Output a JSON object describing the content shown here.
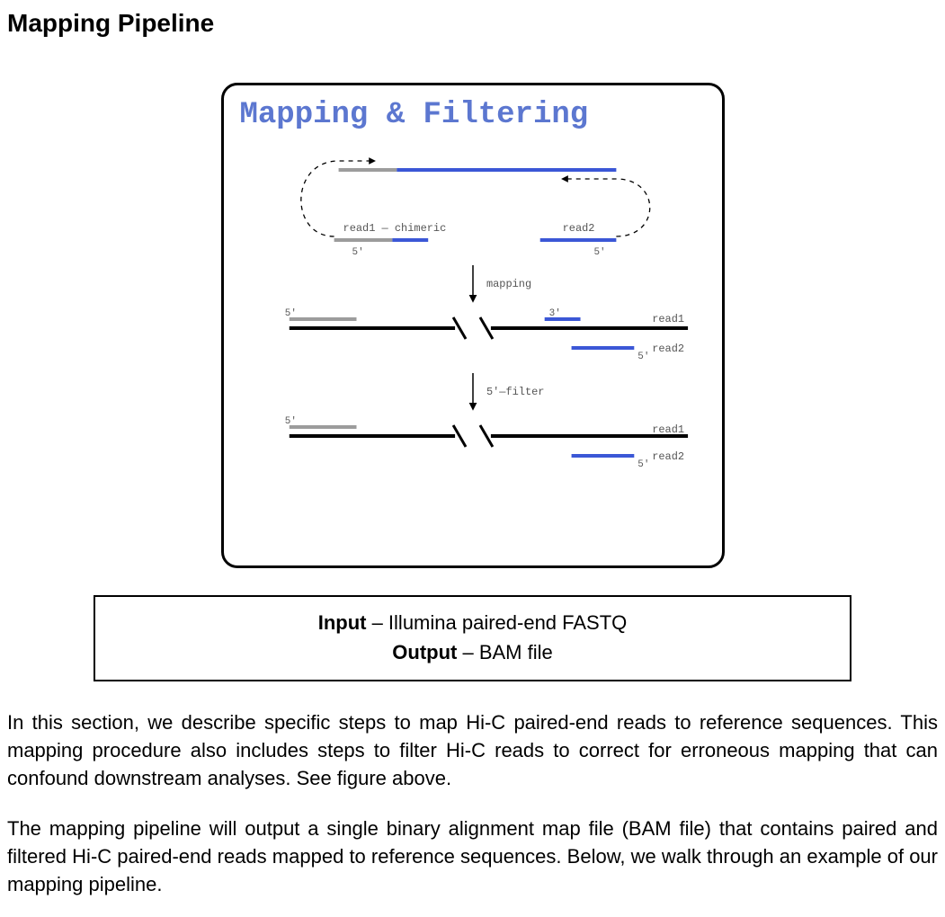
{
  "title": "Mapping Pipeline",
  "figure": {
    "heading": "Mapping & Filtering",
    "labels": {
      "read1_chimeric": "read1 — chimeric",
      "read2": "read2",
      "five_prime_a": "5'",
      "five_prime_b": "5'",
      "mapping_arrow": "mapping",
      "five_prime_c": "5'",
      "three_prime": "3'",
      "read1_right_a": "read1",
      "five_prime_d": "5'",
      "read2_right_a": "read2",
      "filter_arrow": "5'—filter",
      "five_prime_e": "5'",
      "read1_right_b": "read1",
      "five_prime_f": "5'",
      "read2_right_b": "read2"
    }
  },
  "io": {
    "input_label": "Input",
    "input_value": " – Illumina paired-end FASTQ",
    "output_label": "Output",
    "output_value": " – BAM file"
  },
  "paragraph1": "In this section, we describe specific steps to map Hi-C paired-end reads to reference sequences. This mapping procedure also includes steps to filter Hi-C reads to correct for erroneous mapping that can confound downstream analyses. See figure above.",
  "paragraph2": "The mapping pipeline will output a single binary alignment map file (BAM file) that contains paired and filtered Hi-C paired-end reads mapped to reference sequences. Below, we walk through an example of our mapping pipeline."
}
